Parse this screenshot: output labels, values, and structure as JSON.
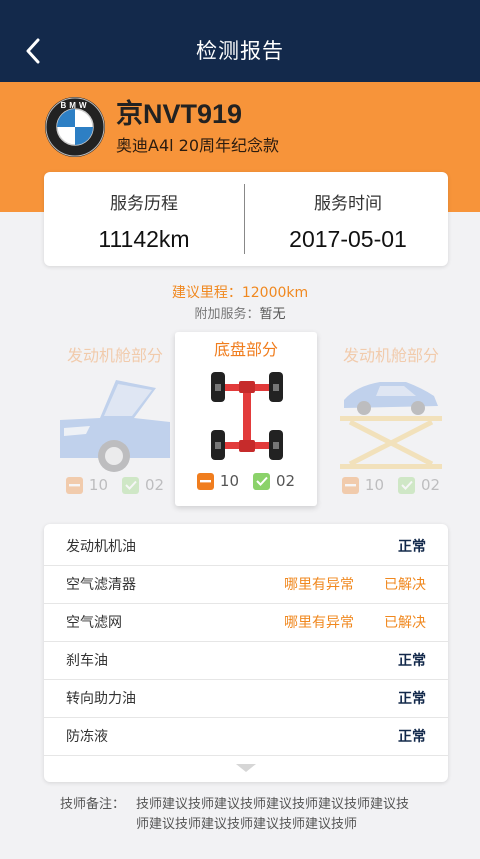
{
  "header": {
    "title": "检测报告",
    "back_icon": "chevron-left-icon"
  },
  "vehicle": {
    "plate": "京NVT919",
    "model": "奥迪A4l 20周年纪念款",
    "logo_icon": "bmw-logo-icon",
    "logo_text": "BMW"
  },
  "stats": {
    "mileage_label": "服务历程",
    "mileage_value": "11142km",
    "time_label": "服务时间",
    "time_value": "2017-05-01"
  },
  "suggest": {
    "text": "建议里程：12000km"
  },
  "extra_service": {
    "label": "附加服务：",
    "value": "暂无"
  },
  "parts": [
    {
      "title": "发动机舱部分",
      "abnormal": "10",
      "normal": "02",
      "icon": "engine-car-icon"
    },
    {
      "title": "底盘部分",
      "abnormal": "10",
      "normal": "02",
      "icon": "chassis-icon"
    },
    {
      "title": "发动机舱部分",
      "abnormal": "10",
      "normal": "02",
      "icon": "car-lift-icon"
    }
  ],
  "checks": [
    {
      "name": "发动机机油",
      "issue": "",
      "status": "正常"
    },
    {
      "name": "空气滤清器",
      "issue": "哪里有异常",
      "status": "已解决"
    },
    {
      "name": "空气滤网",
      "issue": "哪里有异常",
      "status": "已解决"
    },
    {
      "name": "刹车油",
      "issue": "",
      "status": "正常"
    },
    {
      "name": "转向助力油",
      "issue": "",
      "status": "正常"
    },
    {
      "name": "防冻液",
      "issue": "",
      "status": "正常"
    }
  ],
  "note": {
    "label": "技师备注：",
    "text": "技师建议技师建议技师建议技师建议技师建议技师建议技师建议技师建议技师建议技师"
  },
  "colors": {
    "navbar": "#13294b",
    "accent": "#f7943a",
    "orange_text": "#f0881f",
    "green": "#8bd26a"
  }
}
